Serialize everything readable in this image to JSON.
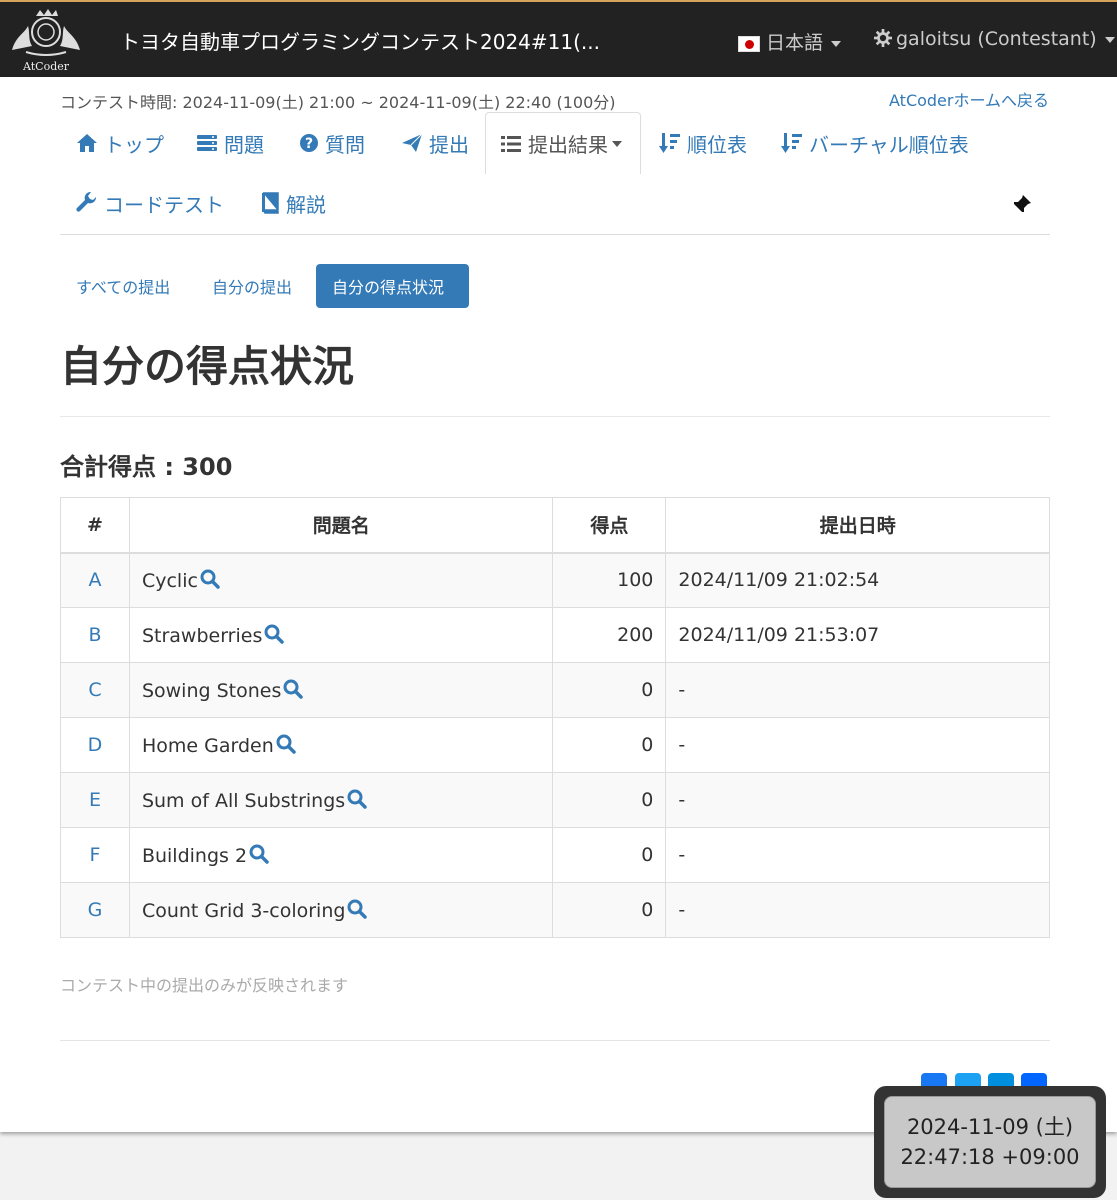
{
  "header": {
    "logo_text": "AtCoder",
    "brand": "トヨタ自動車プログラミングコンテスト2024#11(...",
    "language": "日本語",
    "user": "galoitsu (Contestant)"
  },
  "contest": {
    "time_text": "コンテスト時間: 2024-11-09(土) 21:00 ~ 2024-11-09(土) 22:40 (100分)",
    "home_link": "AtCoderホームへ戻る"
  },
  "nav": {
    "top": "トップ",
    "tasks": "問題",
    "clar": "質問",
    "submit": "提出",
    "results": "提出結果",
    "standings": "順位表",
    "virtual": "バーチャル順位表",
    "codetest": "コードテスト",
    "editorial": "解説"
  },
  "pills": {
    "all": "すべての提出",
    "mine": "自分の提出",
    "score": "自分の得点状況"
  },
  "page": {
    "title": "自分の得点状況",
    "total": "合計得点 : 300"
  },
  "table": {
    "headers": [
      "#",
      "問題名",
      "得点",
      "提出日時"
    ],
    "rows": [
      {
        "id": "A",
        "name": "Cyclic",
        "score": "100",
        "time": "2024/11/09 21:02:54"
      },
      {
        "id": "B",
        "name": "Strawberries",
        "score": "200",
        "time": "2024/11/09 21:53:07"
      },
      {
        "id": "C",
        "name": "Sowing Stones",
        "score": "0",
        "time": "-"
      },
      {
        "id": "D",
        "name": "Home Garden",
        "score": "0",
        "time": "-"
      },
      {
        "id": "E",
        "name": "Sum of All Substrings",
        "score": "0",
        "time": "-"
      },
      {
        "id": "F",
        "name": "Buildings 2",
        "score": "0",
        "time": "-"
      },
      {
        "id": "G",
        "name": "Count Grid 3-coloring",
        "score": "0",
        "time": "-"
      }
    ]
  },
  "footer": {
    "note": "コンテスト中の提出のみが反映されます"
  },
  "clock": {
    "date": "2024-11-09 (土)",
    "time": "22:47:18 +09:00"
  },
  "colors": {
    "accent": "#337ab7",
    "topbar": "#222222"
  }
}
